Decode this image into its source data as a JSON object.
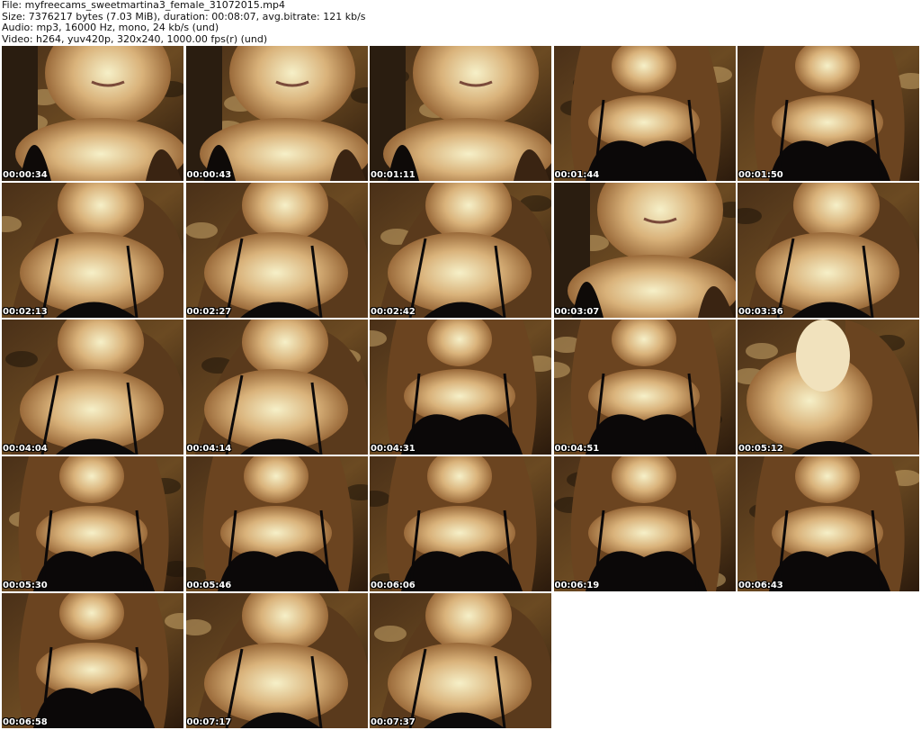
{
  "header": {
    "file": "File: myfreecams_sweetmartina3_female_31072015.mp4",
    "size": "Size: 7376217 bytes (7.03 MiB), duration: 00:08:07, avg.bitrate: 121 kb/s",
    "audio": "Audio: mp3, 16000 Hz, mono, 24 kb/s (und)",
    "video": "Video: h264, yuv420p, 320x240, 1000.00 fps(r) (und)"
  },
  "thumbnails": [
    {
      "time": "00:00:34",
      "scene": "close-face"
    },
    {
      "time": "00:00:43",
      "scene": "close-face"
    },
    {
      "time": "00:01:11",
      "scene": "close-face"
    },
    {
      "time": "00:01:44",
      "scene": "wide"
    },
    {
      "time": "00:01:50",
      "scene": "wide"
    },
    {
      "time": "00:02:13",
      "scene": "mid"
    },
    {
      "time": "00:02:27",
      "scene": "mid"
    },
    {
      "time": "00:02:42",
      "scene": "mid"
    },
    {
      "time": "00:03:07",
      "scene": "close-face"
    },
    {
      "time": "00:03:36",
      "scene": "mid"
    },
    {
      "time": "00:04:04",
      "scene": "mid"
    },
    {
      "time": "00:04:14",
      "scene": "mid"
    },
    {
      "time": "00:04:31",
      "scene": "wide"
    },
    {
      "time": "00:04:51",
      "scene": "wide"
    },
    {
      "time": "00:05:12",
      "scene": "hand"
    },
    {
      "time": "00:05:30",
      "scene": "wide"
    },
    {
      "time": "00:05:46",
      "scene": "wide"
    },
    {
      "time": "00:06:06",
      "scene": "wide"
    },
    {
      "time": "00:06:19",
      "scene": "wide"
    },
    {
      "time": "00:06:43",
      "scene": "wide"
    },
    {
      "time": "00:06:58",
      "scene": "wide"
    },
    {
      "time": "00:07:17",
      "scene": "mid"
    },
    {
      "time": "00:07:37",
      "scene": "mid"
    }
  ],
  "colors": {
    "background": "#ffffff",
    "header_text": "#111111",
    "timestamp_text": "#ffffff",
    "timestamp_outline": "#000000"
  }
}
